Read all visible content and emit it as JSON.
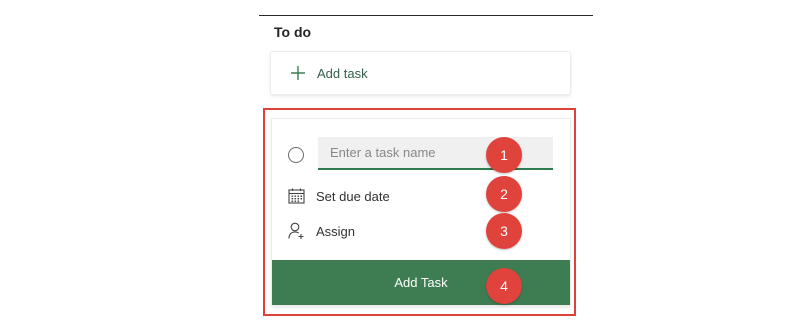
{
  "bucket": {
    "title": "To do",
    "add_task_label": "Add task"
  },
  "task_form": {
    "name_placeholder": "Enter a task name",
    "due_date_label": "Set due date",
    "assign_label": "Assign",
    "submit_label": "Add Task"
  },
  "callouts": [
    "1",
    "2",
    "3",
    "4"
  ],
  "icons": {
    "add": "plus-icon",
    "complete": "circle-icon",
    "due_date": "calendar-icon",
    "assign": "person-add-icon"
  },
  "colors": {
    "accent_green": "#3e7d52",
    "field_underline": "#2f7a4f",
    "callout_red": "#e0423c",
    "highlight_border": "#e0403a"
  }
}
